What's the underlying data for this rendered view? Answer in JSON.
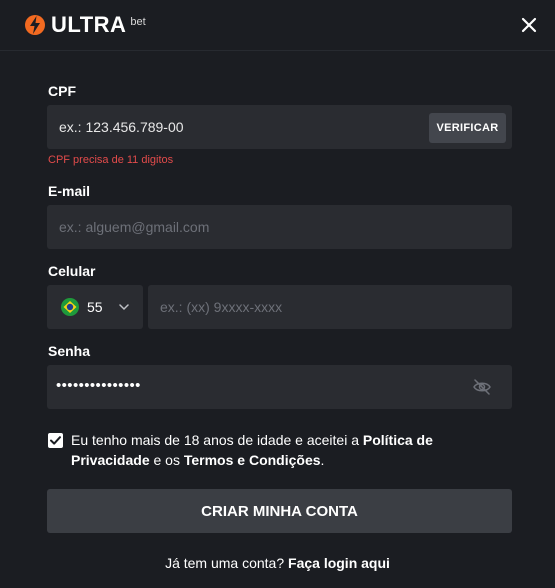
{
  "brand": {
    "name": "ULTRA",
    "suffix": "bet",
    "accent": "#f26a21"
  },
  "cpf": {
    "label": "CPF",
    "placeholder": "ex.: 123.456.789-00",
    "verify_label": "VERIFICAR",
    "error": "CPF precisa de 11 digitos"
  },
  "email": {
    "label": "E-mail",
    "placeholder": "ex.: alguem@gmail.com"
  },
  "phone": {
    "label": "Celular",
    "country_flag": "brazil-flag-icon",
    "country_code": "55",
    "placeholder": "ex.: (xx) 9xxxx-xxxx"
  },
  "password": {
    "label": "Senha",
    "masked_value": "•••••••••••••••"
  },
  "terms": {
    "checked": true,
    "text_1": "Eu tenho mais de 18 anos de idade e aceitei a ",
    "link_privacy": "Política de Privacidade",
    "text_2": " e os ",
    "link_terms": "Termos e Condições",
    "text_3": "."
  },
  "submit_label": "CRIAR MINHA CONTA",
  "login": {
    "prompt": "Já tem uma conta? ",
    "link": "Faça login aqui"
  },
  "colors": {
    "background": "#1b1d22",
    "field": "#2a2c31",
    "error": "#e24b4b"
  }
}
